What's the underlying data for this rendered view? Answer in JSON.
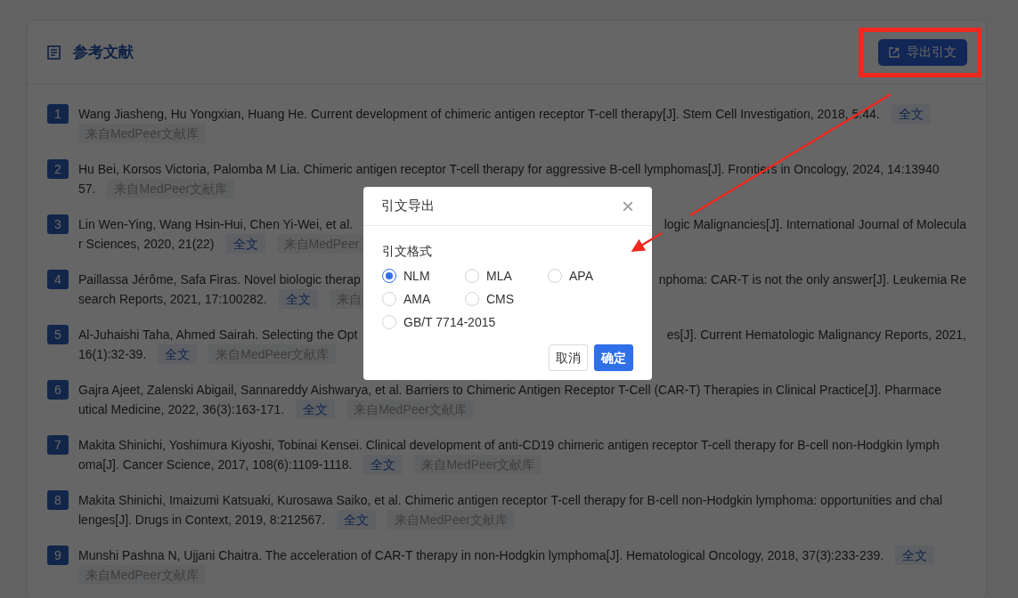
{
  "section": {
    "title": "参考文献",
    "export_button": "导出引文"
  },
  "references": [
    {
      "number": "1",
      "lines": [
        {
          "left": [
            {
              "kind": "text",
              "text": "Wang Jiasheng, Hu Yongxian, Huang He. Current development of chimeric antigen receptor T-cell therapy[J]. Stem Cell Investigation, 2018, 5:44."
            },
            {
              "kind": "fulltext",
              "text": "全文"
            }
          ]
        },
        {
          "left": [
            {
              "kind": "source",
              "text": "来自MedPeer文献库"
            }
          ]
        }
      ]
    },
    {
      "number": "2",
      "lines": [
        {
          "left": [
            {
              "kind": "text",
              "text": "Hu Bei, Korsos Victoria, Palomba M Lia. Chimeric antigen receptor T-cell therapy for aggressive B-cell lymphomas[J]. Frontiers in Oncology, 2024, 14:13940"
            }
          ]
        },
        {
          "left": [
            {
              "kind": "text",
              "text": "57."
            },
            {
              "kind": "source",
              "text": "来自MedPeer文献库"
            }
          ]
        }
      ]
    },
    {
      "number": "3",
      "lines": [
        {
          "left": [
            {
              "kind": "text",
              "text": "Lin Wen-Ying, Wang Hsin-Hui, Chen Yi-Wei, et al."
            }
          ],
          "right": [
            {
              "kind": "text",
              "text": "logic Malignancies[J]. International Journal of Molecula"
            }
          ]
        },
        {
          "left": [
            {
              "kind": "text",
              "text": "r Sciences, 2020, 21(22)"
            },
            {
              "kind": "fulltext",
              "text": "全文"
            },
            {
              "kind": "source",
              "text": "来自MedPeer"
            }
          ]
        }
      ]
    },
    {
      "number": "4",
      "lines": [
        {
          "left": [
            {
              "kind": "text",
              "text": "Paillassa Jérôme, Safa Firas. Novel biologic therap"
            }
          ],
          "right": [
            {
              "kind": "text",
              "text": "nphoma: CAR-T is not the only answer[J]. Leukemia Re"
            }
          ]
        },
        {
          "left": [
            {
              "kind": "text",
              "text": "search Reports, 2021, 17:100282."
            },
            {
              "kind": "fulltext",
              "text": "全文"
            },
            {
              "kind": "source",
              "text": "来自"
            }
          ]
        }
      ]
    },
    {
      "number": "5",
      "lines": [
        {
          "left": [
            {
              "kind": "text",
              "text": "Al-Juhaishi Taha, Ahmed Sairah. Selecting the Opt"
            }
          ],
          "right": [
            {
              "kind": "text",
              "text": "es[J]. Current Hematologic Malignancy Reports, 2021,"
            }
          ]
        },
        {
          "left": [
            {
              "kind": "text",
              "text": "16(1):32-39."
            },
            {
              "kind": "fulltext",
              "text": "全文"
            },
            {
              "kind": "source",
              "text": "来自MedPeer文献库"
            }
          ]
        }
      ]
    },
    {
      "number": "6",
      "lines": [
        {
          "left": [
            {
              "kind": "text",
              "text": "Gajra Ajeet, Zalenski Abigail, Sannareddy Aishwarya, et al. Barriers to Chimeric Antigen Receptor T-Cell (CAR-T) Therapies in Clinical Practice[J]. Pharmace"
            }
          ]
        },
        {
          "left": [
            {
              "kind": "text",
              "text": "utical Medicine, 2022, 36(3):163-171."
            },
            {
              "kind": "fulltext",
              "text": "全文"
            },
            {
              "kind": "source",
              "text": "来自MedPeer文献库"
            }
          ]
        }
      ]
    },
    {
      "number": "7",
      "lines": [
        {
          "left": [
            {
              "kind": "text",
              "text": "Makita Shinichi, Yoshimura Kiyoshi, Tobinai Kensei. Clinical development of anti-CD19 chimeric antigen receptor T-cell therapy for B-cell non-Hodgkin lymph"
            }
          ]
        },
        {
          "left": [
            {
              "kind": "text",
              "text": "oma[J]. Cancer Science, 2017, 108(6):1109-1118."
            },
            {
              "kind": "fulltext",
              "text": "全文"
            },
            {
              "kind": "source",
              "text": "来自MedPeer文献库"
            }
          ]
        }
      ]
    },
    {
      "number": "8",
      "lines": [
        {
          "left": [
            {
              "kind": "text",
              "text": "Makita Shinichi, Imaizumi Katsuaki, Kurosawa Saiko, et al. Chimeric antigen receptor T-cell therapy for B-cell non-Hodgkin lymphoma: opportunities and chal"
            }
          ]
        },
        {
          "left": [
            {
              "kind": "text",
              "text": "lenges[J]. Drugs in Context, 2019, 8:212567."
            },
            {
              "kind": "fulltext",
              "text": "全文"
            },
            {
              "kind": "source",
              "text": "来自MedPeer文献库"
            }
          ]
        }
      ]
    },
    {
      "number": "9",
      "lines": [
        {
          "left": [
            {
              "kind": "text",
              "text": "Munshi Pashna N, Ujjani Chaitra. The acceleration of CAR-T therapy in non-Hodgkin lymphoma[J]. Hematological Oncology, 2018, 37(3):233-239."
            },
            {
              "kind": "fulltext",
              "text": "全文"
            }
          ]
        },
        {
          "left": [
            {
              "kind": "source",
              "text": "来自MedPeer文献库"
            }
          ]
        }
      ]
    }
  ],
  "dialog": {
    "title": "引文导出",
    "close": "×",
    "field_label": "引文格式",
    "format_rows": [
      [
        {
          "label": "NLM",
          "selected": true
        },
        {
          "label": "MLA",
          "selected": false
        },
        {
          "label": "APA",
          "selected": false
        }
      ],
      [
        {
          "label": "AMA",
          "selected": false
        },
        {
          "label": "CMS",
          "selected": false
        }
      ],
      [
        {
          "label": "GB/T 7714-2015",
          "selected": false
        }
      ]
    ],
    "buttons": [
      {
        "kind": "secondary",
        "text": "取消"
      },
      {
        "kind": "primary",
        "text": "确定"
      }
    ]
  }
}
